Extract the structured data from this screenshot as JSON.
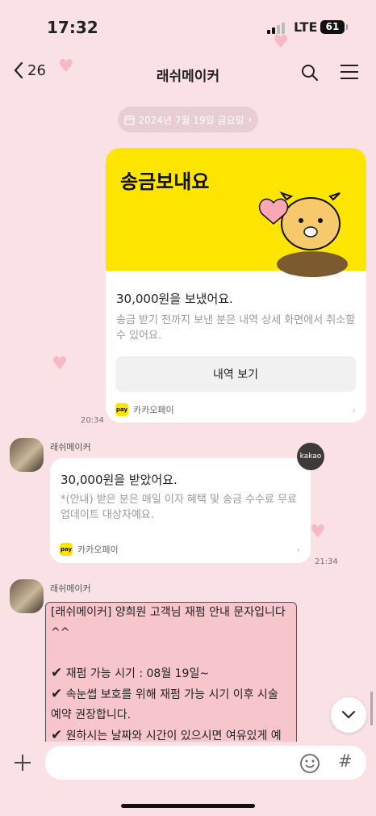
{
  "status": {
    "time": "17:32",
    "network": "LTE",
    "battery": "61"
  },
  "header": {
    "back_count": "26",
    "title": "래쉬메이커"
  },
  "date_divider": "2024년 7월 19일 금요일",
  "transfer_card": {
    "title": "송금보내요",
    "amount_text": "30,000원을 보냈어요.",
    "description": "송금 받기 전까지 보낸 분은 내역 상세 화면에서 취소할 수 있어요.",
    "button_label": "내역 보기",
    "pay_label": "카카오페이",
    "pay_logo": "pay",
    "timestamp": "20:34"
  },
  "received": {
    "sender": "래쉬메이커",
    "amount_text": "30,000원을 받았어요.",
    "description": "*(안내) 받은 분은 매일 이자 혜택 및 송금 수수료 무료 업데이트 대상자예요.",
    "pay_label": "카카오페이",
    "pay_logo": "pay",
    "badge": "kakao",
    "timestamp": "21:34"
  },
  "message": {
    "sender": "래쉬메이커",
    "lines": [
      "[래쉬메이커] 양희원 고객님 재펌 안내 문자입니다^^",
      "재펌 가능 시기 :  08월 19일~",
      "속눈썹 보호를 위해 재펌 가능 시기 이후 시술 예약 권장합니다.",
      "원하시는 날짜와 시간이 있으시면 여유있게 예약 부탁드립니다!"
    ]
  },
  "input": {
    "hash_label": "#"
  },
  "icons": [
    "chevron-left-icon",
    "search-icon",
    "menu-icon",
    "calendar-icon",
    "chevron-right-icon",
    "check-icon",
    "chevron-down-icon",
    "plus-icon",
    "emoji-icon",
    "heart-icon"
  ],
  "colors": {
    "background": "#f9e1e6",
    "kakao_yellow": "#fee500",
    "bubble": "#f7c6cd"
  }
}
